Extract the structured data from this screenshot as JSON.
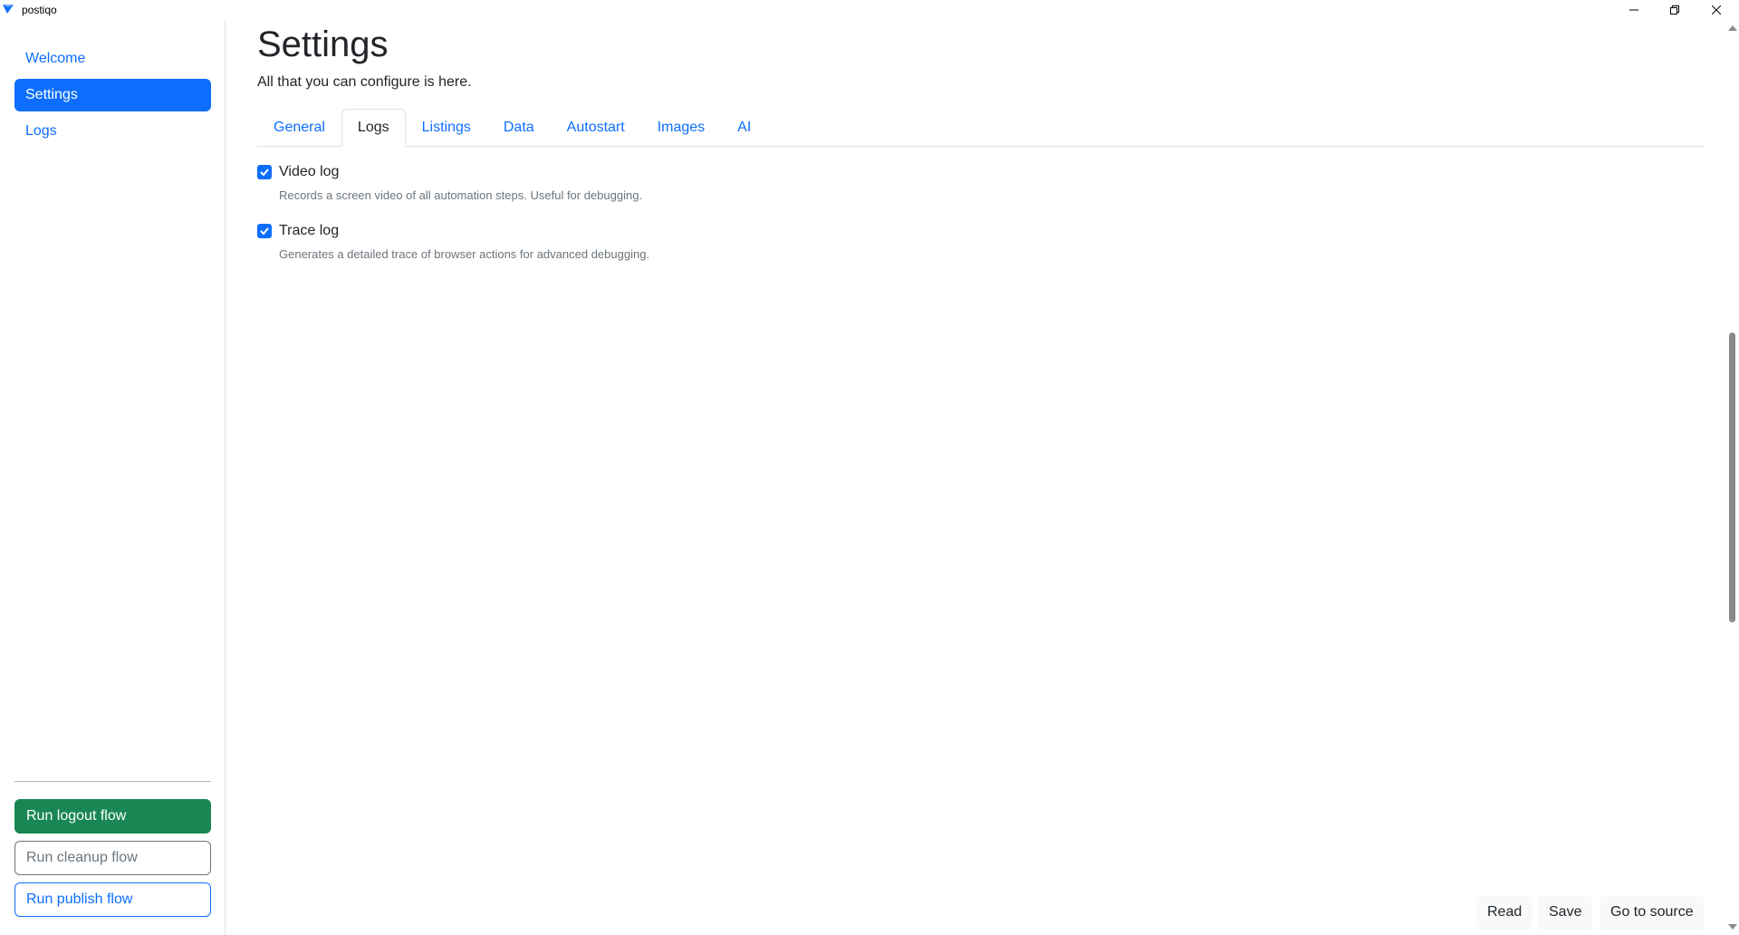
{
  "window": {
    "title": "postiqo",
    "icons": {
      "app": "send-icon",
      "minimize": "minimize-icon",
      "maximize": "restore-icon",
      "close": "close-icon"
    }
  },
  "sidebar": {
    "items": [
      {
        "label": "Welcome",
        "active": false
      },
      {
        "label": "Settings",
        "active": true
      },
      {
        "label": "Logs",
        "active": false
      }
    ],
    "flows": {
      "logout": "Run logout flow",
      "cleanup": "Run cleanup flow",
      "publish": "Run publish flow"
    }
  },
  "main": {
    "title": "Settings",
    "subtitle": "All that you can configure is here.",
    "tabs": [
      {
        "label": "General",
        "active": false
      },
      {
        "label": "Logs",
        "active": true
      },
      {
        "label": "Listings",
        "active": false
      },
      {
        "label": "Data",
        "active": false
      },
      {
        "label": "Autostart",
        "active": false
      },
      {
        "label": "Images",
        "active": false
      },
      {
        "label": "AI",
        "active": false
      }
    ],
    "options": [
      {
        "label": "Video log",
        "help": "Records a screen video of all automation steps. Useful for debugging.",
        "checked": true
      },
      {
        "label": "Trace log",
        "help": "Generates a detailed trace of browser actions for advanced debugging.",
        "checked": true
      }
    ]
  },
  "footer": {
    "read": "Read",
    "save": "Save",
    "source": "Go to source"
  },
  "colors": {
    "primary": "#0d6efd",
    "success": "#198754",
    "secondary": "#6c757d"
  }
}
